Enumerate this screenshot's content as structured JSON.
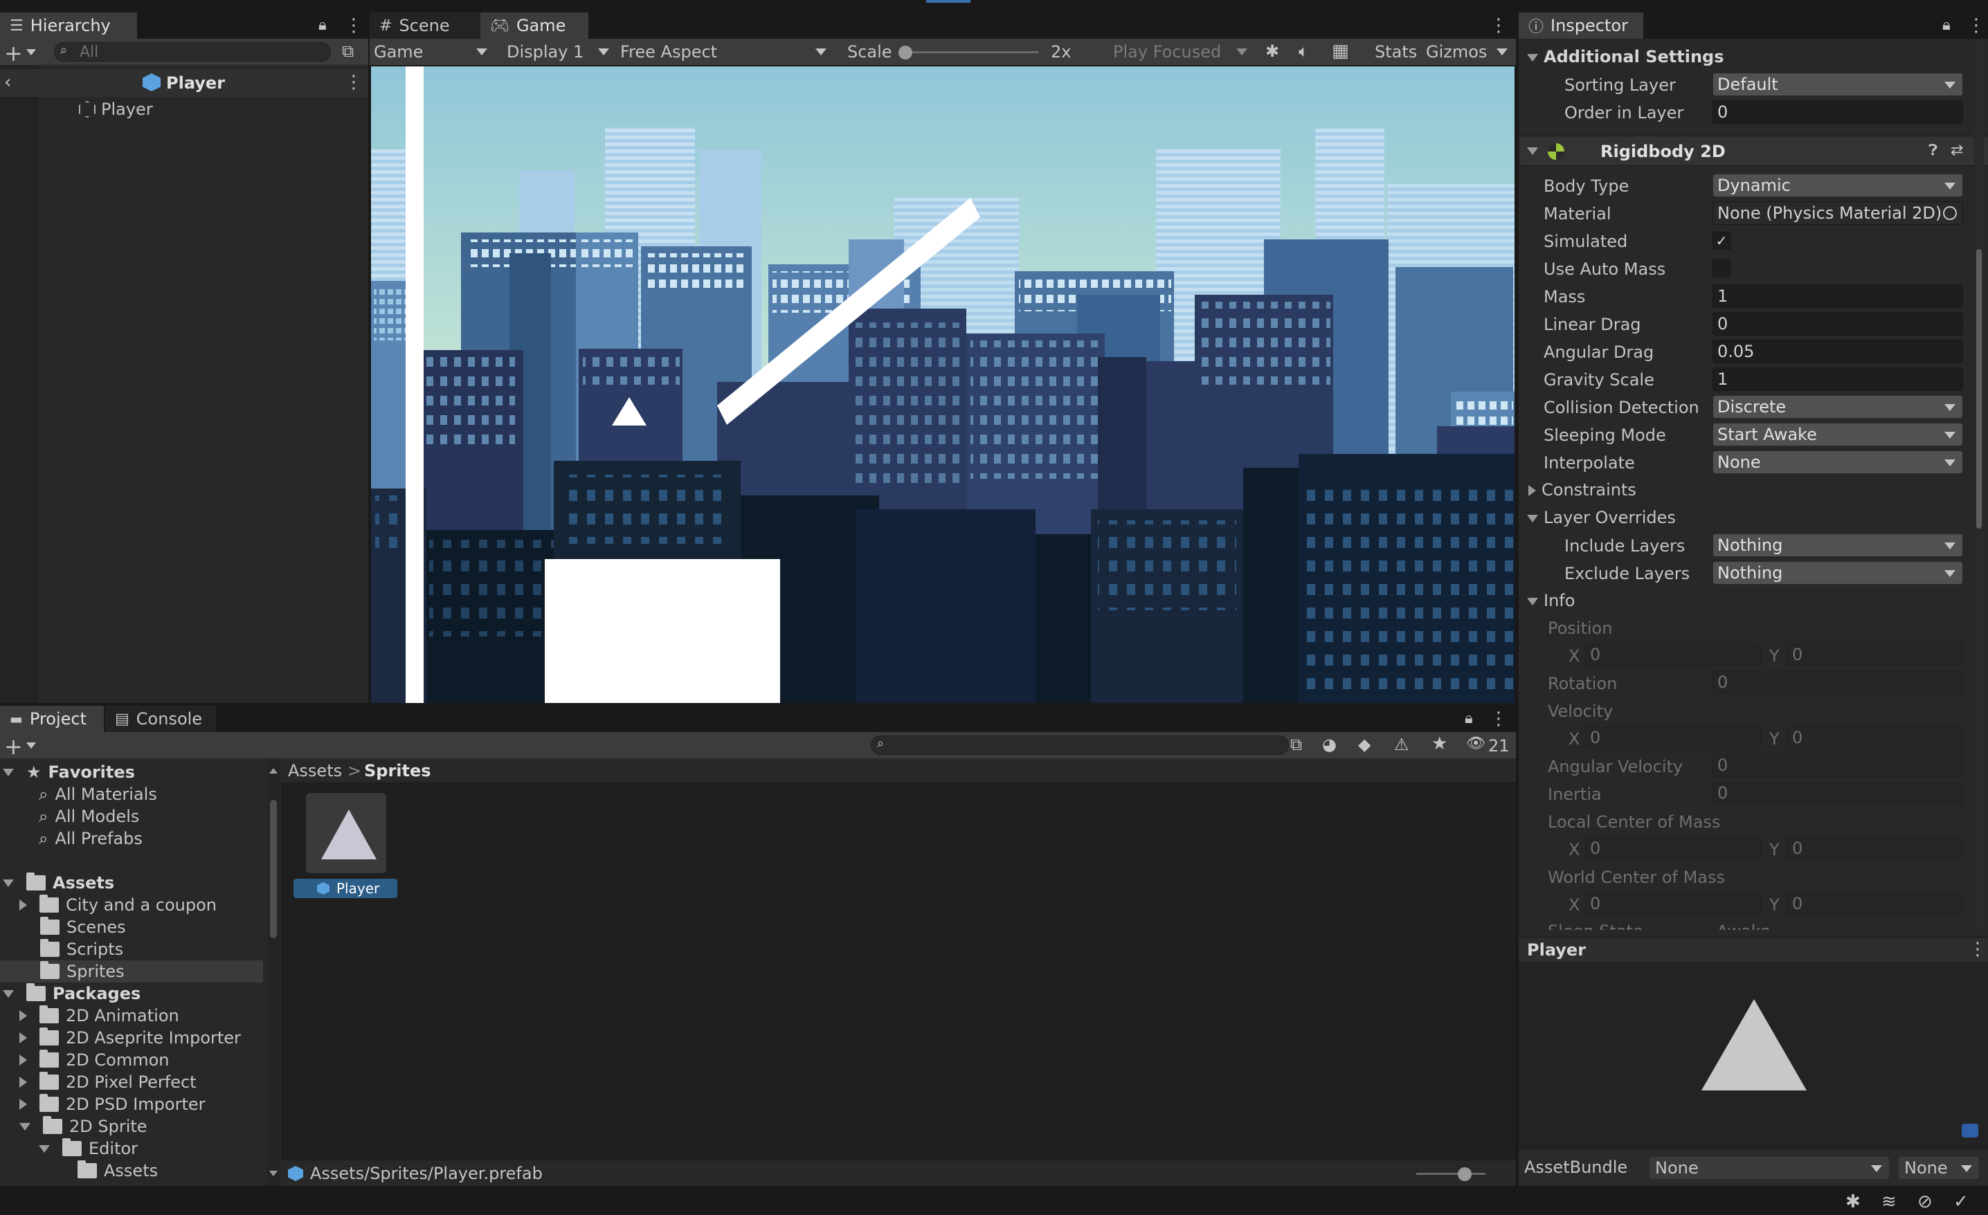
{
  "hierarchy": {
    "tab_label": "Hierarchy",
    "search_placeholder": "All",
    "header_title": "Player",
    "items": [
      "Player"
    ]
  },
  "scene_view": {
    "tabs": [
      "Scene",
      "Game"
    ],
    "active_tab": "Game",
    "toolbar": {
      "mode": "Game",
      "display": "Display 1",
      "aspect": "Free Aspect",
      "scale_label": "Scale",
      "scale_value": "2x",
      "play_focused": "Play Focused",
      "stats": "Stats",
      "gizmos": "Gizmos"
    }
  },
  "inspector": {
    "tab_label": "Inspector",
    "additional_settings": {
      "title": "Additional Settings",
      "sorting_layer_label": "Sorting Layer",
      "sorting_layer_value": "Default",
      "order_label": "Order in Layer",
      "order_value": "0"
    },
    "rigidbody": {
      "title": "Rigidbody 2D",
      "body_type_label": "Body Type",
      "body_type_value": "Dynamic",
      "material_label": "Material",
      "material_value": "None (Physics Material 2D)",
      "simulated_label": "Simulated",
      "simulated": true,
      "auto_mass_label": "Use Auto Mass",
      "auto_mass": false,
      "mass_label": "Mass",
      "mass_value": "1",
      "linear_drag_label": "Linear Drag",
      "linear_drag_value": "0",
      "angular_drag_label": "Angular Drag",
      "angular_drag_value": "0.05",
      "gravity_label": "Gravity Scale",
      "gravity_value": "1",
      "collision_label": "Collision Detection",
      "collision_value": "Discrete",
      "sleeping_label": "Sleeping Mode",
      "sleeping_value": "Start Awake",
      "interpolate_label": "Interpolate",
      "interpolate_value": "None",
      "constraints_label": "Constraints",
      "layer_overrides_label": "Layer Overrides",
      "include_label": "Include Layers",
      "include_value": "Nothing",
      "exclude_label": "Exclude Layers",
      "exclude_value": "Nothing",
      "info_label": "Info",
      "position_label": "Position",
      "rotation_label": "Rotation",
      "rotation_value": "0",
      "velocity_label": "Velocity",
      "angular_velocity_label": "Angular Velocity",
      "angular_velocity_value": "0",
      "inertia_label": "Inertia",
      "inertia_value": "0",
      "local_com_label": "Local Center of Mass",
      "world_com_label": "World Center of Mass",
      "x_label": "X",
      "y_label": "Y",
      "zero": "0",
      "sleep_state_label": "Sleep State",
      "sleep_state_value": "Awake"
    },
    "preview_title": "Player",
    "assetbundle_label": "AssetBundle",
    "assetbundle_value": "None",
    "assetbundle_variant": "None"
  },
  "project": {
    "tabs": [
      "Project",
      "Console"
    ],
    "hidden_count": "21",
    "favorites_label": "Favorites",
    "favorites": [
      "All Materials",
      "All Models",
      "All Prefabs"
    ],
    "assets_label": "Assets",
    "assets_children": [
      "City and a coupon",
      "Scenes",
      "Scripts",
      "Sprites"
    ],
    "packages_label": "Packages",
    "packages_children": [
      "2D Animation",
      "2D Aseprite Importer",
      "2D Common",
      "2D Pixel Perfect",
      "2D PSD Importer",
      "2D Sprite"
    ],
    "editor_label": "Editor",
    "editor_assets_label": "Assets",
    "breadcrumb": [
      "Assets",
      "Sprites"
    ],
    "breadcrumb_sep": ">",
    "grid_items": [
      "Player"
    ],
    "footer_path": "Assets/Sprites/Player.prefab"
  },
  "colors": {
    "editor_bg": "#282828",
    "toolbar_bg": "#3c3c3c",
    "field_bg": "#1e1e1e",
    "selection": "#2c5d87",
    "sky": "#a9d3dc"
  }
}
